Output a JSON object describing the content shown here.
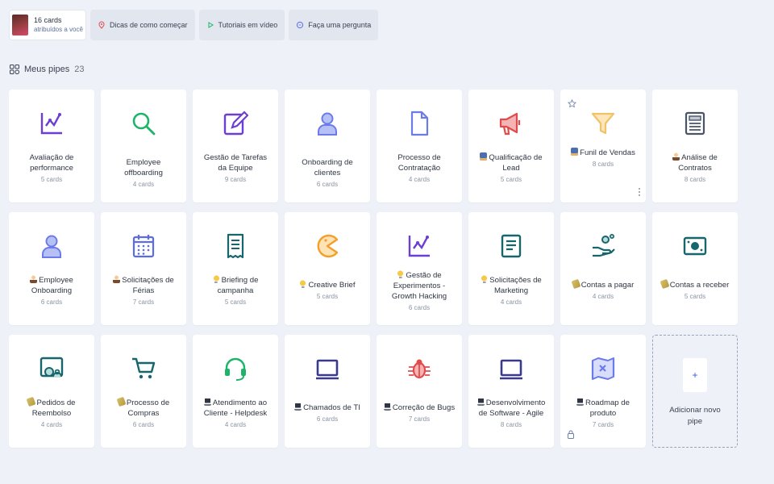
{
  "topbar": {
    "user": {
      "cards": "16 cards",
      "assigned": "atribuídos a você"
    },
    "chips": [
      {
        "label": "Dicas de como começar",
        "icon": "pin-icon"
      },
      {
        "label": "Tutoriais em vídeo",
        "icon": "play-icon"
      },
      {
        "label": "Faça uma pergunta",
        "icon": "chat-icon"
      }
    ]
  },
  "section": {
    "title": "Meus pipes",
    "count": "23"
  },
  "pipes": [
    {
      "name": "Avaliação de performance",
      "count": "5 cards",
      "icon": "line-chart-icon",
      "color": "#6c3fd1"
    },
    {
      "name": "Employee offboarding",
      "count": "4 cards",
      "icon": "search-icon",
      "color": "#1db469"
    },
    {
      "name": "Gestão de Tarefas da Equipe",
      "count": "9 cards",
      "icon": "edit-icon",
      "color": "#6c3fd1"
    },
    {
      "name": "Onboarding de clientes",
      "count": "6 cards",
      "icon": "user-icon",
      "color": "#6b7bea"
    },
    {
      "name": "Processo de Contratação",
      "count": "4 cards",
      "icon": "document-icon",
      "color": "#6b7bea"
    },
    {
      "name": "Qualificação de Lead",
      "count": "5 cards",
      "icon": "megaphone-icon",
      "color": "#e24b4b",
      "emoji": "clip"
    },
    {
      "name": "Funil de Vendas",
      "count": "8 cards",
      "icon": "funnel-icon",
      "color": "#f0c36a",
      "emoji": "clip"
    },
    {
      "name": "Análise de Contratos",
      "count": "8 cards",
      "icon": "news-icon",
      "color": "#4a5466",
      "emoji": "person"
    },
    {
      "name": "Employee Onboarding",
      "count": "6 cards",
      "icon": "user-icon",
      "color": "#6b7bea",
      "emoji": "person"
    },
    {
      "name": "Solicitações de Férias",
      "count": "7 cards",
      "icon": "calendar-icon",
      "color": "#5b6de6",
      "emoji": "person"
    },
    {
      "name": "Briefing de campanha",
      "count": "5 cards",
      "icon": "receipt-icon",
      "color": "#17666b",
      "emoji": "bulb"
    },
    {
      "name": "Creative Brief",
      "count": "5 cards",
      "icon": "pacman-icon",
      "color": "#f59f28",
      "emoji": "bulb"
    },
    {
      "name": "Gestão de Experimentos - Growth Hacking",
      "count": "6 cards",
      "icon": "line-chart-icon",
      "color": "#6c3fd1",
      "emoji": "bulb"
    },
    {
      "name": "Solicitações de Marketing",
      "count": "4 cards",
      "icon": "document-lines-icon",
      "color": "#17666b",
      "emoji": "bulb"
    },
    {
      "name": "Contas a pagar",
      "count": "4 cards",
      "icon": "hand-coin-icon",
      "color": "#17666b",
      "emoji": "money"
    },
    {
      "name": "Contas a receber",
      "count": "5 cards",
      "icon": "money-bill-icon",
      "color": "#17666b",
      "emoji": "money"
    },
    {
      "name": "Pedidos de Reembolso",
      "count": "4 cards",
      "icon": "image-person-icon",
      "color": "#17666b",
      "emoji": "money"
    },
    {
      "name": "Processo de Compras",
      "count": "6 cards",
      "icon": "cart-icon",
      "color": "#17666b",
      "emoji": "money"
    },
    {
      "name": "Atendimento ao Cliente - Helpdesk",
      "count": "4 cards",
      "icon": "headset-icon",
      "color": "#1db469",
      "emoji": "laptop"
    },
    {
      "name": "Chamados de TI",
      "count": "6 cards",
      "icon": "monitor-icon",
      "color": "#3b3a8a",
      "emoji": "laptop"
    },
    {
      "name": "Correção de Bugs",
      "count": "7 cards",
      "icon": "bug-icon",
      "color": "#e24b4b",
      "emoji": "laptop"
    },
    {
      "name": "Desenvolvimento de Software - Agile",
      "count": "8 cards",
      "icon": "monitor-icon",
      "color": "#3b3a8a",
      "emoji": "laptop"
    },
    {
      "name": "Roadmap de produto",
      "count": "7 cards",
      "icon": "map-icon",
      "color": "#6b7bea",
      "emoji": "laptop"
    }
  ],
  "add_pipe": {
    "plus": "+",
    "label": "Adicionar novo pipe"
  }
}
